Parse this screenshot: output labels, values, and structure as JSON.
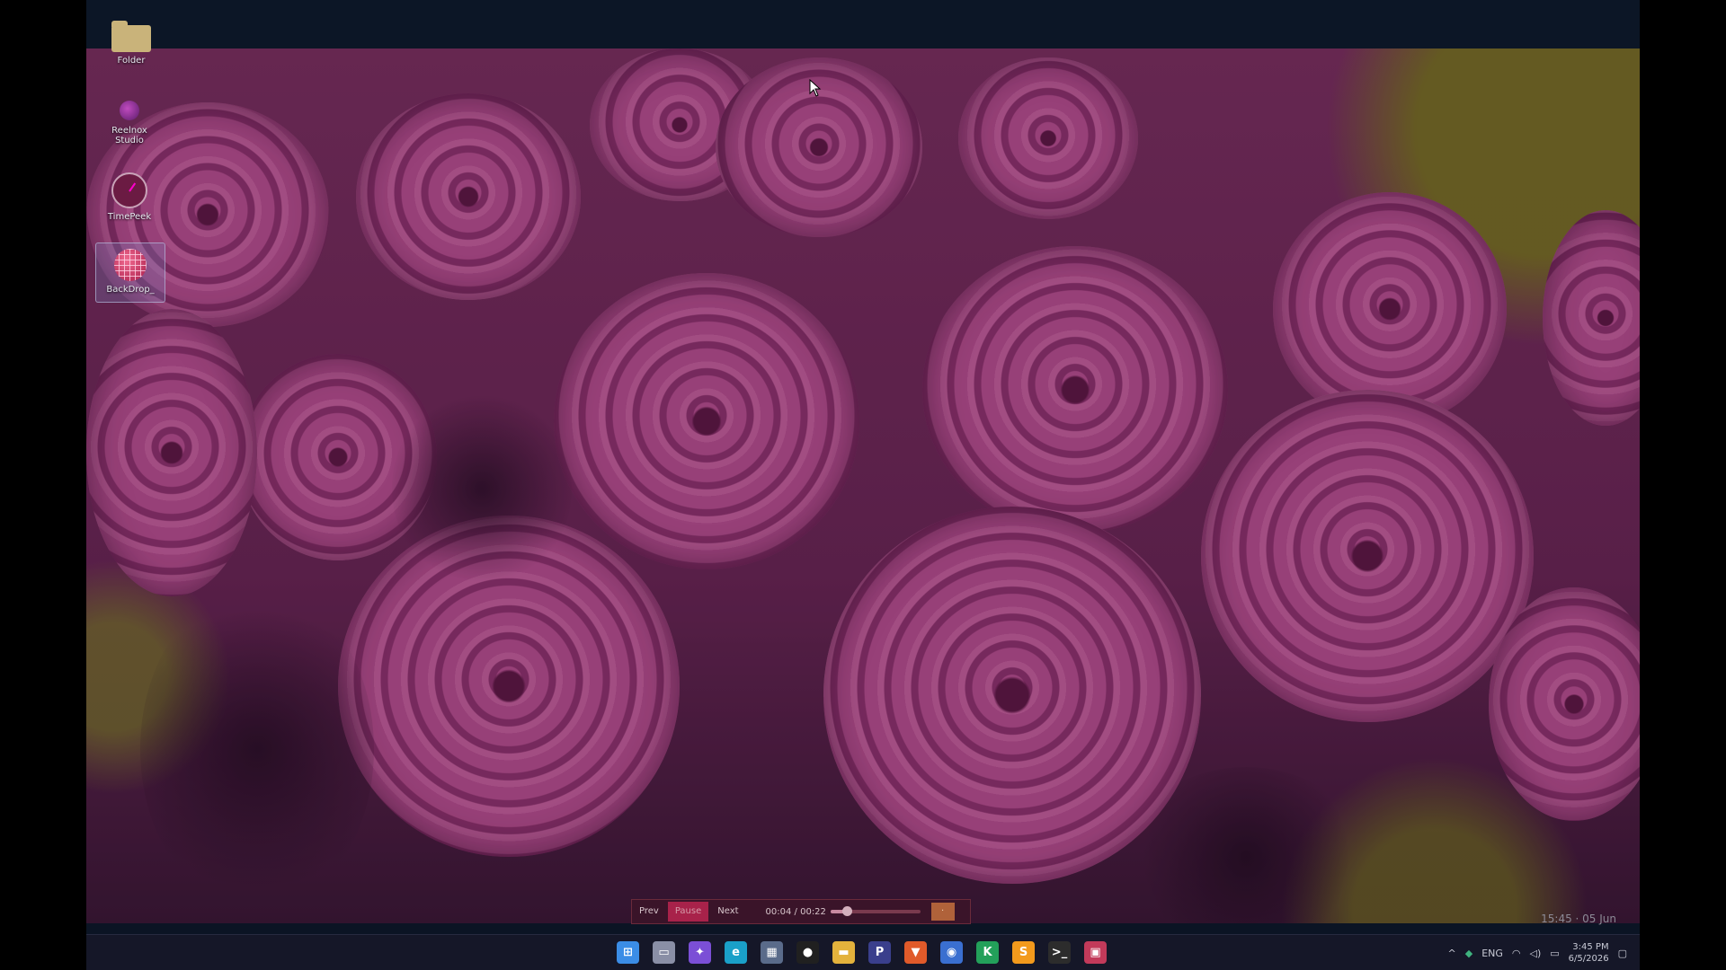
{
  "desktop": {
    "icons": [
      {
        "label": "Folder",
        "icon": "folder-icon"
      },
      {
        "label": "Reelnox Studio",
        "icon": "reelnox-app-icon"
      },
      {
        "label": "TimePeek",
        "icon": "clock-app-icon"
      },
      {
        "label": "BackDrop_",
        "icon": "globe-app-icon"
      }
    ],
    "overlay_clock": "15:45 · 05 Jun"
  },
  "player": {
    "prev_label": "Prev",
    "pause_label": "Pause",
    "next_label": "Next",
    "time_label": "00:04 / 00:22",
    "progress": 0.18,
    "mini_label": "·"
  },
  "taskbar": {
    "apps": [
      {
        "name": "windows-start-icon",
        "glyph": "⊞",
        "color": "#3b8de6"
      },
      {
        "name": "task-view-icon",
        "glyph": "▭",
        "color": "#8a8fa6"
      },
      {
        "name": "copilot-icon",
        "glyph": "✦",
        "color": "#7b4fd6"
      },
      {
        "name": "edge-browser-icon",
        "glyph": "e",
        "color": "#1aa0c8"
      },
      {
        "name": "store-icon",
        "glyph": "▦",
        "color": "#5a6b8a"
      },
      {
        "name": "chat-icon",
        "glyph": "●",
        "color": "#202020"
      },
      {
        "name": "file-explorer-icon",
        "glyph": "▬",
        "color": "#e3b23c"
      },
      {
        "name": "p-app-icon",
        "glyph": "P",
        "color": "#3a3f8c"
      },
      {
        "name": "brave-browser-icon",
        "glyph": "▼",
        "color": "#e05a2a"
      },
      {
        "name": "messenger-icon",
        "glyph": "◉",
        "color": "#3a6fd0"
      },
      {
        "name": "k-app-icon",
        "glyph": "K",
        "color": "#23a05a"
      },
      {
        "name": "sublime-text-icon",
        "glyph": "S",
        "color": "#f39a1c"
      },
      {
        "name": "terminal-icon",
        "glyph": ">_",
        "color": "#2c2c2c"
      },
      {
        "name": "backdrop-app-icon",
        "glyph": "▣",
        "color": "#c23a5a"
      }
    ],
    "tray": {
      "chevron": "^",
      "language": "ENG",
      "time": "3:45 PM",
      "date": "6/5/2026"
    }
  }
}
